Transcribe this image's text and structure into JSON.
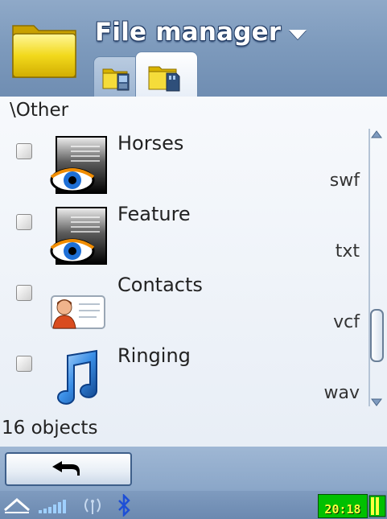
{
  "header": {
    "title": "File manager",
    "tabs": [
      {
        "icon": "phone-memory-folder-icon",
        "active": false
      },
      {
        "icon": "memory-card-folder-icon",
        "active": true
      }
    ]
  },
  "content": {
    "path": "\\Other",
    "items": [
      {
        "name": "Horses",
        "ext": "swf",
        "icon": "eye-file-icon"
      },
      {
        "name": "Feature",
        "ext": "txt",
        "icon": "eye-file-icon"
      },
      {
        "name": "Contacts",
        "ext": "vcf",
        "icon": "contact-card-icon"
      },
      {
        "name": "Ringing",
        "ext": "wav",
        "icon": "music-note-icon"
      }
    ],
    "status": "16 objects"
  },
  "softkeys": {
    "back_icon": "back-arrow-icon"
  },
  "system": {
    "time": "20:18"
  },
  "colors": {
    "header": "#7e9bbd",
    "clock_bg": "#00c000",
    "accent": "#3e5f8a"
  }
}
